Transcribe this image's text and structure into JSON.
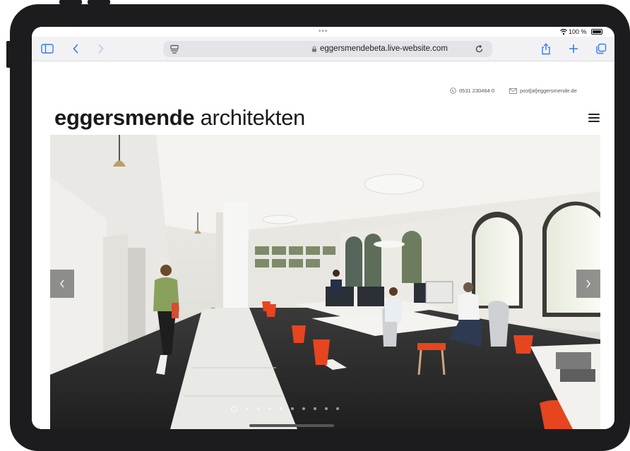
{
  "status_bar": {
    "dots": "•••",
    "battery_label": "100 %"
  },
  "browser": {
    "url": "eggersmendebeta.live-website.com",
    "toolbar_buttons": [
      "sidebar-icon",
      "back-icon",
      "forward-icon",
      "reader-icon",
      "reload-icon",
      "share-icon",
      "new-tab-icon",
      "tabs-icon"
    ]
  },
  "site": {
    "contact": {
      "phone": "0531 230464 0",
      "email": "post[at]eggersmende.de"
    },
    "logo": {
      "bold": "eggersmende",
      "light": "architekten"
    },
    "slider": {
      "slide_count": 10,
      "active_index": 0
    }
  },
  "colors": {
    "device": "#1c1c1e",
    "toolbar": "#f2f2f4",
    "accent": "#2f7cf6",
    "floor": "#2a2a2a",
    "trash_orange": "#e6451f"
  }
}
